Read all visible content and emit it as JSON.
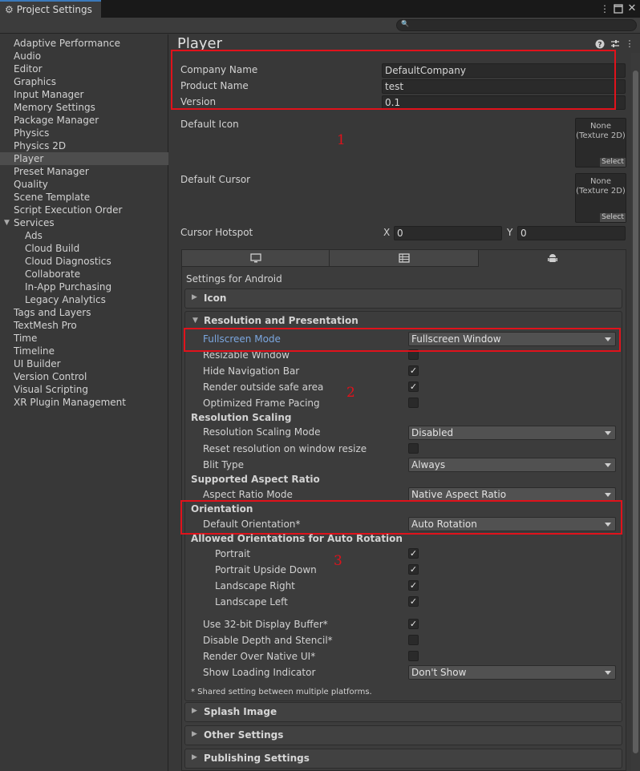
{
  "window": {
    "tab_title": "Project Settings",
    "tab_icon": "gear-icon",
    "buttons": [
      "more-vert-icon",
      "maximize-icon",
      "close-icon"
    ],
    "search_placeholder": ""
  },
  "sidebar": {
    "items": [
      {
        "label": "Adaptive Performance",
        "indent": 0
      },
      {
        "label": "Audio",
        "indent": 0
      },
      {
        "label": "Editor",
        "indent": 0
      },
      {
        "label": "Graphics",
        "indent": 0
      },
      {
        "label": "Input Manager",
        "indent": 0
      },
      {
        "label": "Memory Settings",
        "indent": 0
      },
      {
        "label": "Package Manager",
        "indent": 0
      },
      {
        "label": "Physics",
        "indent": 0
      },
      {
        "label": "Physics 2D",
        "indent": 0
      },
      {
        "label": "Player",
        "indent": 0,
        "selected": true
      },
      {
        "label": "Preset Manager",
        "indent": 0
      },
      {
        "label": "Quality",
        "indent": 0
      },
      {
        "label": "Scene Template",
        "indent": 0
      },
      {
        "label": "Script Execution Order",
        "indent": 0
      },
      {
        "label": "Services",
        "indent": 0,
        "expanded": true
      },
      {
        "label": "Ads",
        "indent": 1
      },
      {
        "label": "Cloud Build",
        "indent": 1
      },
      {
        "label": "Cloud Diagnostics",
        "indent": 1
      },
      {
        "label": "Collaborate",
        "indent": 1
      },
      {
        "label": "In-App Purchasing",
        "indent": 1
      },
      {
        "label": "Legacy Analytics",
        "indent": 1
      },
      {
        "label": "Tags and Layers",
        "indent": 0
      },
      {
        "label": "TextMesh Pro",
        "indent": 0
      },
      {
        "label": "Time",
        "indent": 0
      },
      {
        "label": "Timeline",
        "indent": 0
      },
      {
        "label": "UI Builder",
        "indent": 0
      },
      {
        "label": "Version Control",
        "indent": 0
      },
      {
        "label": "Visual Scripting",
        "indent": 0
      },
      {
        "label": "XR Plugin Management",
        "indent": 0
      }
    ]
  },
  "player": {
    "title": "Player",
    "header_icons": [
      "help-icon",
      "presets-icon",
      "more-vert-icon"
    ],
    "company_name_label": "Company Name",
    "company_name": "DefaultCompany",
    "product_name_label": "Product Name",
    "product_name": "test",
    "version_label": "Version",
    "version": "0.1",
    "default_icon_label": "Default Icon",
    "default_cursor_label": "Default Cursor",
    "texture_none": "None",
    "texture_type": "(Texture 2D)",
    "select_label": "Select",
    "cursor_hotspot_label": "Cursor Hotspot",
    "hotspot_x_label": "X",
    "hotspot_x": "0",
    "hotspot_y_label": "Y",
    "hotspot_y": "0"
  },
  "platform_tabs": [
    {
      "icon": "monitor-icon",
      "active": false
    },
    {
      "icon": "webgl-icon",
      "active": false
    },
    {
      "icon": "android-icon",
      "active": true
    }
  ],
  "android": {
    "settings_for": "Settings for Android",
    "icon_section": "Icon",
    "resolution_section": "Resolution and Presentation",
    "fullscreen_mode_label": "Fullscreen Mode",
    "fullscreen_mode": "Fullscreen Window",
    "resizable_window_label": "Resizable Window",
    "hide_nav_bar_label": "Hide Navigation Bar",
    "hide_nav_bar": true,
    "render_outside_label": "Render outside safe area",
    "render_outside": true,
    "optimized_pacing_label": "Optimized Frame Pacing",
    "optimized_pacing": false,
    "resolution_scaling_header": "Resolution Scaling",
    "scaling_mode_label": "Resolution Scaling Mode",
    "scaling_mode": "Disabled",
    "reset_resolution_label": "Reset resolution on window resize",
    "reset_resolution": false,
    "blit_type_label": "Blit Type",
    "blit_type": "Always",
    "aspect_ratio_header": "Supported Aspect Ratio",
    "aspect_ratio_mode_label": "Aspect Ratio Mode",
    "aspect_ratio_mode": "Native Aspect Ratio",
    "orientation_header": "Orientation",
    "default_orientation_label": "Default Orientation*",
    "default_orientation": "Auto Rotation",
    "allowed_orientations_header": "Allowed Orientations for Auto Rotation",
    "portrait_label": "Portrait",
    "portrait": true,
    "portrait_upside_label": "Portrait Upside Down",
    "portrait_upside": true,
    "landscape_right_label": "Landscape Right",
    "landscape_right": true,
    "landscape_left_label": "Landscape Left",
    "landscape_left": true,
    "display_buffer_label": "Use 32-bit Display Buffer*",
    "display_buffer": true,
    "disable_depth_label": "Disable Depth and Stencil*",
    "disable_depth": false,
    "render_native_ui_label": "Render Over Native UI*",
    "render_native_ui": false,
    "loading_indicator_label": "Show Loading Indicator",
    "loading_indicator": "Don't Show",
    "shared_note": "* Shared setting between multiple platforms.",
    "splash_section": "Splash Image",
    "other_section": "Other Settings",
    "publishing_section": "Publishing Settings"
  },
  "annotations": {
    "one": "1",
    "two": "2",
    "three": "3",
    "color": "#e0121b"
  },
  "colors": {
    "highlight_label": "#7ba7e0",
    "selected_item": "#4d4d4d",
    "tab_accent": "#3a79bb"
  }
}
